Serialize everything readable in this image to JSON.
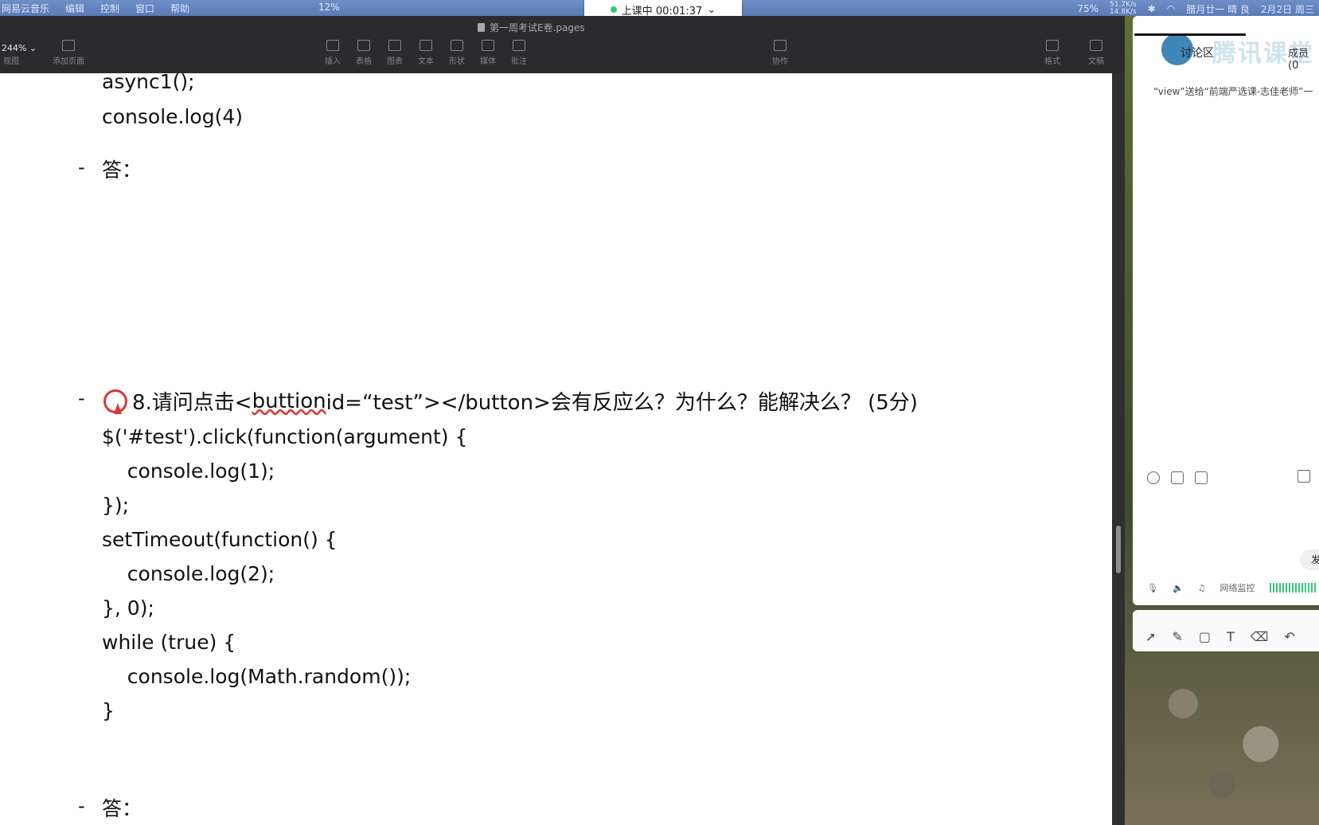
{
  "menubar": {
    "left_items": [
      "网易云音乐",
      "编辑",
      "控制",
      "窗口",
      "帮助"
    ],
    "battery_left": "12%",
    "battery": "75%",
    "net_up": "51.7K/s",
    "net_down": "14.8K/s",
    "calendar": "腊月廿一 晴 良",
    "date": "2月2日 周三"
  },
  "timer": {
    "label": "上课中 00:01:37"
  },
  "pages": {
    "title": "第一周考试E卷.pages",
    "zoom": "244%",
    "toolbar": {
      "view": "视图",
      "add_page": "添加页面",
      "insert": "插入",
      "table": "表格",
      "chart": "图表",
      "text": "文本",
      "shape": "形状",
      "media": "媒体",
      "comment": "批注",
      "collaborate": "协作",
      "format": "格式",
      "document": "文稿"
    },
    "content": {
      "code_top_1": "async1();",
      "code_top_2": "console.log(4)",
      "answer_label_1": "答：",
      "q8_title_pre": "8.请问点击<",
      "q8_title_err": "buttion",
      "q8_title_post": " id=“test”></button>会有反应么？为什么？能解决么？ (5分)",
      "code": [
        "$('#test').click(function(argument) {",
        "    console.log(1);",
        "});",
        "setTimeout(function() {",
        "    console.log(2);",
        "}, 0);",
        "while (true) {",
        "    console.log(Math.random());",
        "}"
      ],
      "answer_label_2": "答："
    }
  },
  "chat": {
    "brand": "腾讯课堂",
    "tab_discuss": "讨论区",
    "tab_members": "成员(0",
    "gift_message": "“view”送给“前端严选课-志佳老师”一",
    "send": "发",
    "network": "网络监控"
  }
}
